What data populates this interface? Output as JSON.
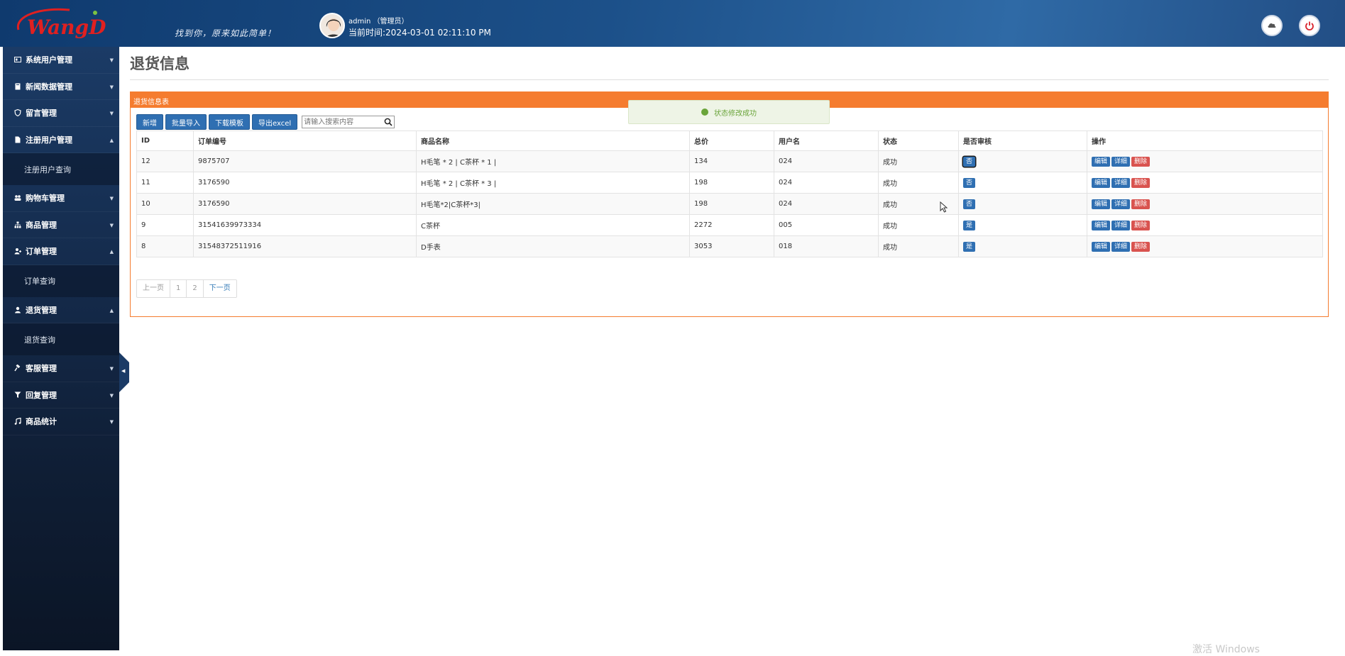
{
  "header": {
    "logo_text": "WangD",
    "slogan": "找到你，原来如此简单！",
    "user": "admin （管理员）",
    "time": "当前时间:2024-03-01 02:11:10 PM"
  },
  "sidebar": {
    "items": [
      {
        "label": "系统用户管理",
        "icon": "id-card-icon",
        "expanded": false
      },
      {
        "label": "新闻数据管理",
        "icon": "book-icon",
        "expanded": false
      },
      {
        "label": "留言管理",
        "icon": "shield-icon",
        "expanded": false
      },
      {
        "label": "注册用户管理",
        "icon": "document-icon",
        "expanded": true,
        "sub": [
          "注册用户查询"
        ]
      },
      {
        "label": "购物车管理",
        "icon": "users-icon",
        "expanded": false
      },
      {
        "label": "商品管理",
        "icon": "sitemap-icon",
        "expanded": false
      },
      {
        "label": "订单管理",
        "icon": "user-plus-icon",
        "expanded": true,
        "sub": [
          "订单查询"
        ]
      },
      {
        "label": "退货管理",
        "icon": "user-icon",
        "expanded": true,
        "sub": [
          "退货查询"
        ]
      },
      {
        "label": "客服管理",
        "icon": "gavel-icon",
        "expanded": false
      },
      {
        "label": "回复管理",
        "icon": "filter-icon",
        "expanded": false
      },
      {
        "label": "商品统计",
        "icon": "music-icon",
        "expanded": false
      }
    ]
  },
  "page": {
    "title": "退货信息",
    "panel_title": "退货信息表"
  },
  "toolbar": {
    "add": "新增",
    "import": "批量导入",
    "template": "下载模板",
    "export": "导出excel",
    "search_placeholder": "请输入搜索内容"
  },
  "toast": "状态修改成功",
  "table": {
    "headers": [
      "ID",
      "订单编号",
      "商品名称",
      "总价",
      "用户名",
      "状态",
      "是否审核",
      "操作"
    ],
    "rows": [
      {
        "id": "12",
        "order": "9875707",
        "goods": "H毛笔 * 2 | C茶杯 * 1 |",
        "total": "134",
        "user": "024",
        "status": "成功",
        "audit": "否"
      },
      {
        "id": "11",
        "order": "3176590",
        "goods": "H毛笔 * 2 | C茶杯 * 3 |",
        "total": "198",
        "user": "024",
        "status": "成功",
        "audit": "否"
      },
      {
        "id": "10",
        "order": "3176590",
        "goods": "H毛笔*2|C茶杯*3|",
        "total": "198",
        "user": "024",
        "status": "成功",
        "audit": "否"
      },
      {
        "id": "9",
        "order": "31541639973334",
        "goods": "C茶杯",
        "total": "2272",
        "user": "005",
        "status": "成功",
        "audit": "是"
      },
      {
        "id": "8",
        "order": "31548372511916",
        "goods": "D手表",
        "total": "3053",
        "user": "018",
        "status": "成功",
        "audit": "是"
      }
    ],
    "actions": {
      "edit": "编辑",
      "detail": "详细",
      "delete": "删除"
    }
  },
  "pager": {
    "prev": "上一页",
    "pages": [
      "1",
      "2"
    ],
    "next": "下一页"
  },
  "watermark": "激活 Windows"
}
